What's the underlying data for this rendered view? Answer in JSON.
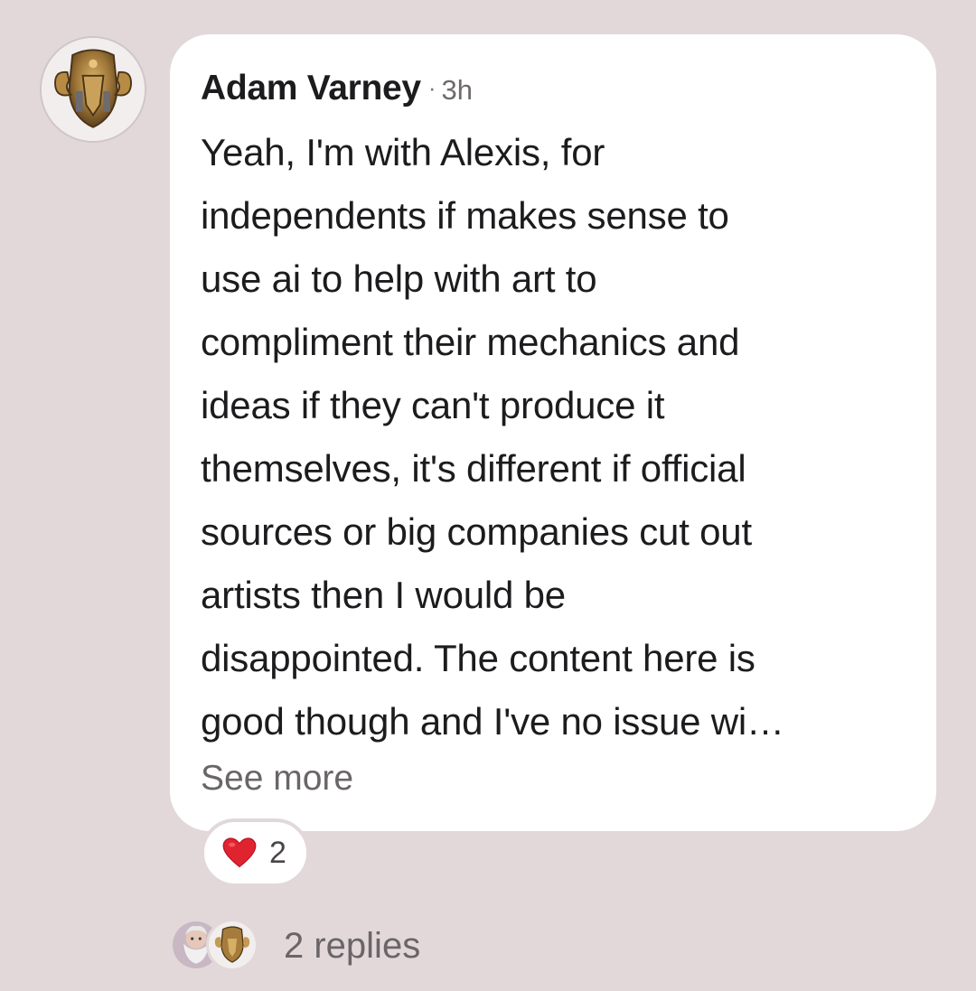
{
  "comment": {
    "author": "Adam Varney",
    "separator": "·",
    "time": "3h",
    "text": "Yeah, I'm with Alexis, for\nindependents if makes sense to\nuse ai to help with art to\ncompliment their mechanics and\nideas if they can't produce it\nthemselves, it's different if official\nsources or big companies cut out\nartists then I would be\ndisappointed. The content here is\ngood though and I've no issue wi…",
    "see_more_label": "See more",
    "avatar_icon": "ram-helmet-avatar"
  },
  "reactions": {
    "icon": "heart-icon",
    "count": "2",
    "color": "#e0242f"
  },
  "replies": {
    "label": "2 replies",
    "avatars": [
      "bearded-man-avatar",
      "ram-helmet-avatar"
    ]
  },
  "colors": {
    "background": "#e2d8da",
    "bubble": "#ffffff",
    "text": "#1c1c1e",
    "muted": "#6a6568"
  }
}
